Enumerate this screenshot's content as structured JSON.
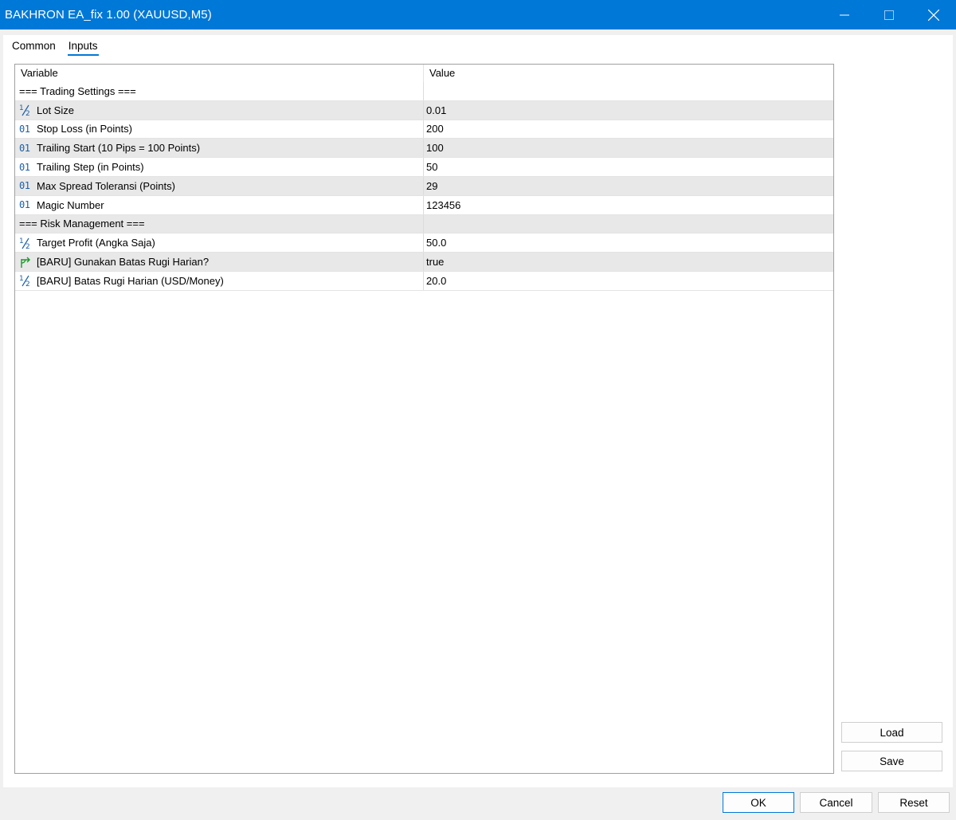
{
  "window": {
    "title": "BAKHRON EA_fix 1.00 (XAUUSD,M5)"
  },
  "tabs": [
    {
      "label": "Common",
      "active": false
    },
    {
      "label": "Inputs",
      "active": true
    }
  ],
  "grid": {
    "headers": {
      "variable": "Variable",
      "value": "Value"
    },
    "rows": [
      {
        "icon": "none",
        "variable": "=== Trading Settings ===",
        "value": ""
      },
      {
        "icon": "double-type-icon",
        "variable": "Lot Size",
        "value": "0.01"
      },
      {
        "icon": "integer-type-icon",
        "variable": "Stop Loss (in Points)",
        "value": "200"
      },
      {
        "icon": "integer-type-icon",
        "variable": "Trailing Start (10 Pips = 100 Points)",
        "value": "100"
      },
      {
        "icon": "integer-type-icon",
        "variable": "Trailing Step (in Points)",
        "value": "50"
      },
      {
        "icon": "integer-type-icon",
        "variable": "Max Spread Toleransi (Points)",
        "value": "29"
      },
      {
        "icon": "integer-type-icon",
        "variable": "Magic Number",
        "value": "123456"
      },
      {
        "icon": "none",
        "variable": "=== Risk Management ===",
        "value": ""
      },
      {
        "icon": "double-type-icon",
        "variable": "Target Profit (Angka Saja)",
        "value": "50.0"
      },
      {
        "icon": "bool-type-icon",
        "variable": "[BARU] Gunakan Batas Rugi Harian?",
        "value": "true"
      },
      {
        "icon": "double-type-icon",
        "variable": "[BARU] Batas Rugi Harian (USD/Money)",
        "value": "20.0"
      }
    ]
  },
  "buttons": {
    "load": "Load",
    "save": "Save",
    "ok": "OK",
    "cancel": "Cancel",
    "reset": "Reset"
  },
  "colors": {
    "titlebar": "#0078d7",
    "tab_underline": "#0078d7",
    "type_icon": "#1d5fa8",
    "bool_icon": "#1a9a2c",
    "row_shade": "#e8e8e8"
  }
}
